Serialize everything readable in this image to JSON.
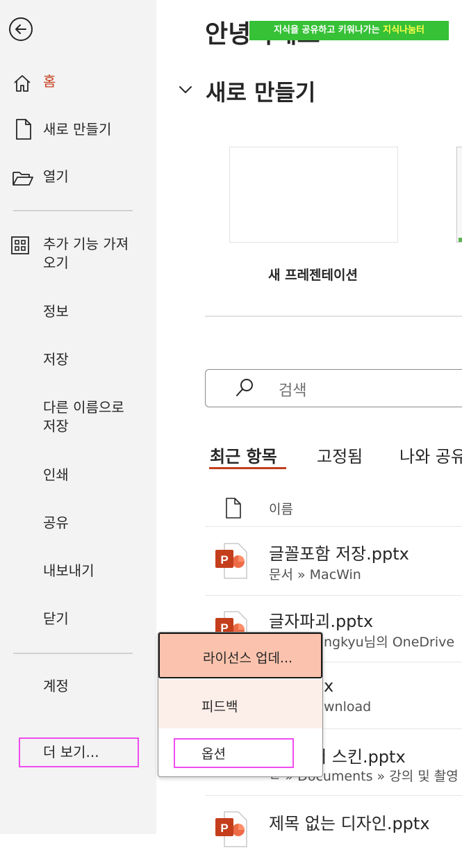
{
  "sidebar": {
    "items": [
      {
        "label": "홈",
        "icon": "home-icon",
        "active": true
      },
      {
        "label": "새로 만들기",
        "icon": "new-file-icon"
      },
      {
        "label": "열기",
        "icon": "open-folder-icon"
      },
      {
        "label": "추가 기능 가져\n오기",
        "icon": "addins-grid-icon"
      },
      {
        "label": "정보"
      },
      {
        "label": "저장"
      },
      {
        "label": "다른 이름으로\n저장"
      },
      {
        "label": "인쇄"
      },
      {
        "label": "공유"
      },
      {
        "label": "내보내기"
      },
      {
        "label": "닫기"
      },
      {
        "label": "계정"
      },
      {
        "label": "더 보기..."
      }
    ]
  },
  "main": {
    "greeting": "안녕하세요",
    "banner": {
      "text": "지식을 공유하고 키워나가는 ",
      "highlight": "지식나눔터"
    },
    "new_section_title": "새로 만들기",
    "template_label": "새 프레젠테이션",
    "search_placeholder": "검색",
    "tabs": [
      {
        "label": "최근 항목",
        "active": true
      },
      {
        "label": "고정됨"
      },
      {
        "label": "나와 공유"
      }
    ],
    "column_name": "이름",
    "files": [
      {
        "name": "글꼴포함 저장.pptx",
        "path": "문서 » MacWin"
      },
      {
        "name": "글자파괴.pptx",
        "path": "ngkyu님의 OneDrive"
      },
      {
        "name": "x",
        "path": "wnload"
      },
      {
        "name": "눔터 스킨.pptx",
        "path": "ㄷ » Documents » 강의 및 촬영"
      },
      {
        "name": "제목 없는 디자인.pptx",
        "path": ""
      }
    ]
  },
  "popup": {
    "items": [
      {
        "label": "라이선스 업데..."
      },
      {
        "label": "피드백"
      },
      {
        "label": "옵션"
      }
    ]
  },
  "colors": {
    "accent": "#c43e1c",
    "highlight_box": "#f04cf0",
    "popup_hover": "#fbc3ad",
    "banner": "#36c136"
  }
}
